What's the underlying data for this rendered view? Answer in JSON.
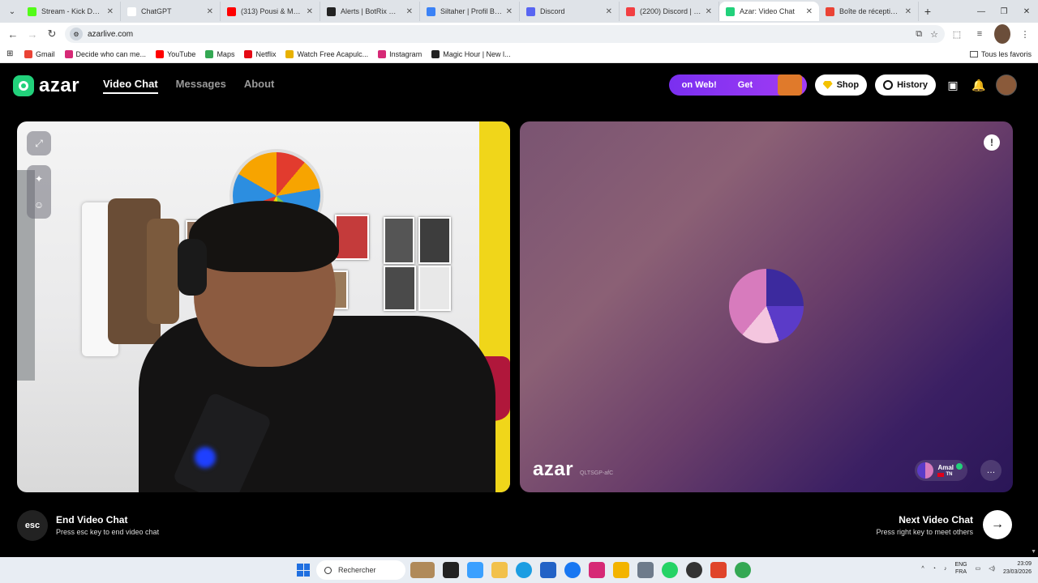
{
  "browser": {
    "tabs": [
      {
        "title": "Stream - Kick Dashbo",
        "color": "#53fc18",
        "active": false
      },
      {
        "title": "ChatGPT",
        "color": "#ffffff",
        "active": false
      },
      {
        "title": "(313) Pousi & Muslim",
        "color": "#ff0000",
        "active": false
      },
      {
        "title": "Alerts | BotRix — Clo",
        "color": "#222222",
        "active": false
      },
      {
        "title": "Siltaher | Profil Bakch",
        "color": "#3b82f6",
        "active": false
      },
      {
        "title": "Discord",
        "color": "#5865f2",
        "active": false
      },
      {
        "title": "(2200) Discord | Frien",
        "color": "#f23f42",
        "active": false
      },
      {
        "title": "Azar: Video Chat",
        "color": "#22d17b",
        "active": true
      },
      {
        "title": "Boîte de réception (2",
        "color": "#ea4335",
        "active": false
      }
    ],
    "url": "azarlive.com",
    "bookmarks": [
      {
        "label": "Gmail",
        "color": "#ea4335"
      },
      {
        "label": "Decide who can me...",
        "color": "#d62976"
      },
      {
        "label": "YouTube",
        "color": "#ff0000"
      },
      {
        "label": "Maps",
        "color": "#34a853"
      },
      {
        "label": "Netflix",
        "color": "#e50914"
      },
      {
        "label": "Watch Free Acapulc...",
        "color": "#e8b100"
      },
      {
        "label": "Instagram",
        "color": "#d62976"
      },
      {
        "label": "Magic Hour | New l...",
        "color": "#222222"
      }
    ],
    "all_bookmarks": "Tous les favoris"
  },
  "app": {
    "brand": "azar",
    "nav": {
      "video_chat": "Video Chat",
      "messages": "Messages",
      "about": "About"
    },
    "promo": {
      "left": "on Web!",
      "right": "Get"
    },
    "shop": "Shop",
    "history": "History"
  },
  "remote": {
    "watermark": "azar",
    "session_id": "QLTSGP-afC",
    "peer_name": "Amal",
    "peer_country": "TN"
  },
  "controls": {
    "esc_key": "esc",
    "end_title": "End Video Chat",
    "end_sub": "Press esc key to end video chat",
    "next_title": "Next Video Chat",
    "next_sub": "Press right key to meet others"
  },
  "taskbar": {
    "search": "Rechercher",
    "lang_top": "ENG",
    "lang_bottom": "FRA",
    "time": "23:09",
    "date": "23/03/2026"
  },
  "colors": {
    "brand_green": "#22d17b",
    "promo_purple": "#8a34f2"
  }
}
